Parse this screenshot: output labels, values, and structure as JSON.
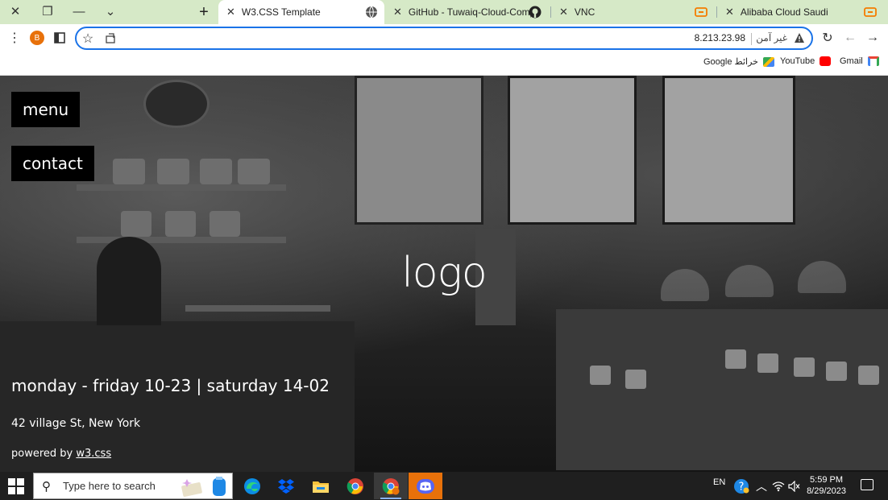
{
  "window": {
    "close_glyph": "✕",
    "restore_glyph": "❐",
    "minimize_glyph": "—",
    "dropdown_glyph": "⌄"
  },
  "tabs": [
    {
      "title": "W3.CSS Template",
      "icon": "globe-icon",
      "active": true
    },
    {
      "title": "GitHub - Tuwaiq-Cloud-Computi",
      "icon": "github-icon",
      "active": false
    },
    {
      "title": "VNC",
      "icon": "cloud-icon",
      "active": false
    },
    {
      "title": "Alibaba Cloud Saudi",
      "icon": "cloud-icon",
      "active": false
    }
  ],
  "toolbar": {
    "profile_initial": "B",
    "url": "8.213.23.98",
    "security_text": "غير آمن",
    "warning_icon": "warning-icon"
  },
  "bookmarks": [
    {
      "label": "Gmail",
      "icon": "gmail-icon",
      "color": "#ea4335"
    },
    {
      "label": "YouTube",
      "icon": "youtube-icon",
      "color": "#ff0000"
    },
    {
      "label": "Google خرائط",
      "icon": "maps-icon",
      "color": "#34a853"
    }
  ],
  "page": {
    "menu_label": "menu",
    "contact_label": "contact",
    "logo_text": "logo",
    "hours": "monday - friday 10-23 | saturday 14-02",
    "address": "42 village St, New York",
    "powered_prefix": "powered by ",
    "powered_link": "w3.css"
  },
  "taskbar": {
    "search_placeholder": "Type here to search",
    "apps": [
      "edge-icon",
      "dropbox-icon",
      "file-explorer-icon",
      "chrome-icon",
      "chrome-profile-icon",
      "discord-icon"
    ],
    "language": "EN",
    "time": "5:59 PM",
    "date": "8/29/2023"
  }
}
